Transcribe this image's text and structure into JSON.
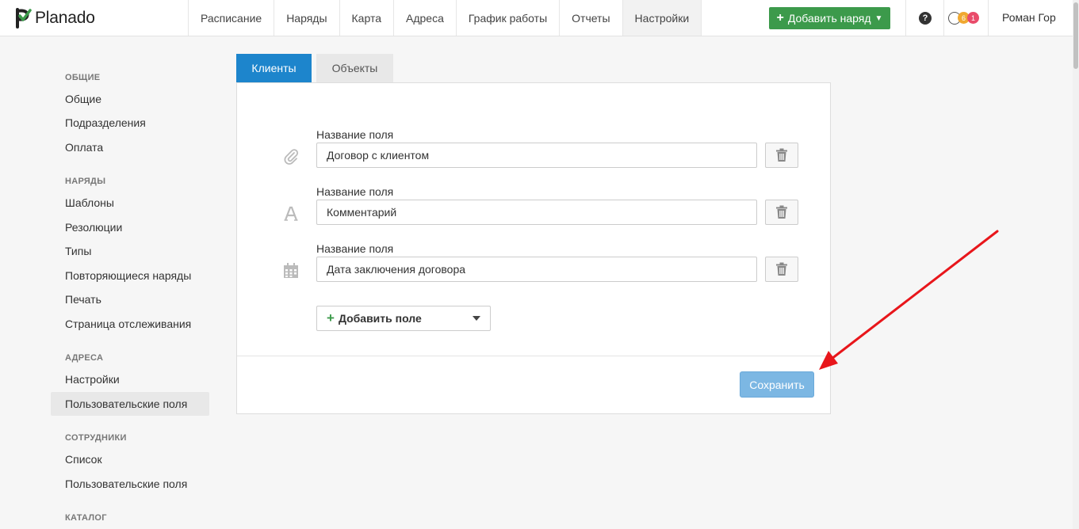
{
  "app": {
    "logo_text": "Planado",
    "logo_color": "#3c9a4b"
  },
  "nav": {
    "items": [
      {
        "label": "Расписание"
      },
      {
        "label": "Наряды"
      },
      {
        "label": "Карта"
      },
      {
        "label": "Адреса"
      },
      {
        "label": "График работы"
      },
      {
        "label": "Отчеты"
      },
      {
        "label": "Настройки",
        "active": true
      }
    ],
    "add_order_label": "Добавить наряд",
    "help_glyph": "?",
    "badge_orange": "6",
    "badge_red": "1",
    "user_name": "Роман Гор"
  },
  "sidebar": {
    "sections": [
      {
        "heading": "ОБЩИЕ",
        "items": [
          "Общие",
          "Подразделения",
          "Оплата"
        ]
      },
      {
        "heading": "НАРЯДЫ",
        "items": [
          "Шаблоны",
          "Резолюции",
          "Типы",
          "Повторяющиеся наряды",
          "Печать",
          "Страница отслеживания"
        ]
      },
      {
        "heading": "АДРЕСА",
        "items": [
          "Настройки",
          "Пользовательские поля"
        ]
      },
      {
        "heading": "СОТРУДНИКИ",
        "items": [
          "Список",
          "Пользовательские поля"
        ]
      },
      {
        "heading": "КАТАЛОГ",
        "items": []
      }
    ],
    "active_item": "Пользовательские поля"
  },
  "tabs": [
    {
      "label": "Клиенты",
      "active": true
    },
    {
      "label": "Объекты",
      "active": false
    }
  ],
  "fields": [
    {
      "label": "Название поля",
      "value": "Договор с клиентом",
      "icon": "paperclip-icon"
    },
    {
      "label": "Название поля",
      "value": "Комментарий",
      "icon": "text-icon"
    },
    {
      "label": "Название поля",
      "value": "Дата заключения договора",
      "icon": "calendar-icon"
    }
  ],
  "add_field_label": "Добавить поле",
  "save_label": "Сохранить",
  "colors": {
    "primary": "#1d85cc",
    "save_disabled": "#7cb7e3",
    "green": "#3c9a4b",
    "annotation_arrow": "#e8161b"
  }
}
